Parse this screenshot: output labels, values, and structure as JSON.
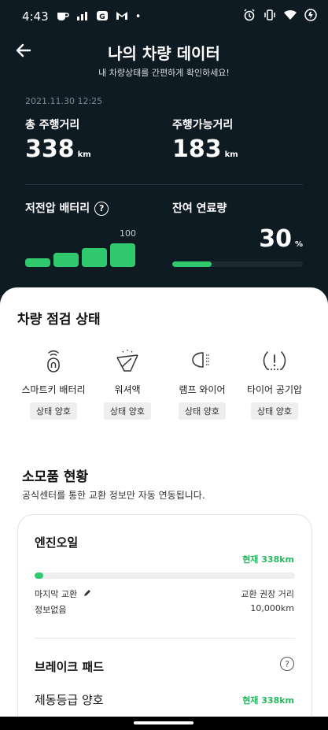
{
  "status_bar": {
    "time": "4:43",
    "dot": "•"
  },
  "colors": {
    "dark_bg": "#0f1b23",
    "accent_green": "#30c96e",
    "green_text": "#27b85f"
  },
  "header": {
    "title": "나의 차량 데이터",
    "subtitle": "내 차량상태를 간편하게 확인하세요!",
    "back_icon": "arrow-left-icon"
  },
  "summary": {
    "date": "2021.11.30 12:25",
    "total_distance": {
      "label": "총 주행거리",
      "value": "338",
      "unit": "km"
    },
    "range": {
      "label": "주행가능거리",
      "value": "183",
      "unit": "km"
    },
    "battery": {
      "label": "저전압 배터리",
      "help": "?",
      "max_label": "100",
      "level_percent": 100
    },
    "fuel": {
      "label": "잔여 연료량",
      "value": "30",
      "unit": "%",
      "level_percent": 30
    }
  },
  "inspection": {
    "title": "차량 점검 상태",
    "items": [
      {
        "name": "스마트키 배터리",
        "status": "상태 양호",
        "icon": "smart-key-icon"
      },
      {
        "name": "워셔액",
        "status": "상태 양호",
        "icon": "washer-fluid-icon"
      },
      {
        "name": "램프 와이어",
        "status": "상태 양호",
        "icon": "lamp-icon"
      },
      {
        "name": "타이어 공기압",
        "status": "상태 양호",
        "icon": "tire-pressure-icon"
      }
    ]
  },
  "consumables": {
    "title": "소모품 현황",
    "description": "공식센터를 통한 교환 정보만 자동 연동됩니다.",
    "engine_oil": {
      "title": "엔진오일",
      "current": "현재 338km",
      "progress_percent": 3.4,
      "last_change_label": "마지막 교환",
      "last_change_value": "정보없음",
      "recommended_label": "교환 권장 거리",
      "recommended_value": "10,000km"
    },
    "brake_pad": {
      "title": "브레이크 패드",
      "help": "?",
      "grade": "제동등급 양호",
      "current": "현재 338km"
    }
  }
}
